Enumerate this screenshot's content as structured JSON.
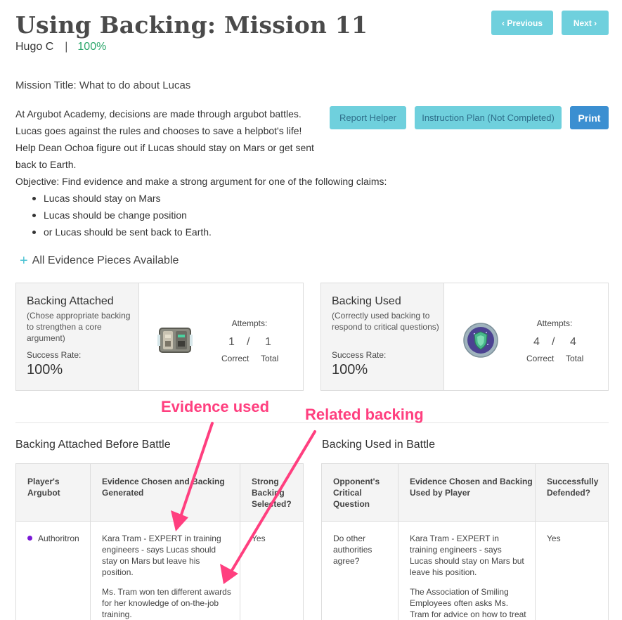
{
  "header": {
    "title": "Using Backing: Mission 11",
    "student": "Hugo C",
    "separator": "|",
    "progress": "100%",
    "prev_label": "‹ Previous",
    "next_label": "Next ›"
  },
  "mission": {
    "title": "Mission Title: What to do about Lucas",
    "description": "At Argubot Academy, decisions are made through argubot battles. Lucas goes against the rules and chooses to save a helpbot's life! Help Dean Ochoa figure out if Lucas should stay on Mars or get sent back to Earth.",
    "objective": "Objective: Find evidence and make a strong argument for one of the following claims:",
    "claims": [
      "Lucas should stay on Mars",
      "Lucas should be change position",
      "or Lucas should be sent back to Earth."
    ]
  },
  "actions": {
    "report_helper": "Report Helper",
    "instruction_plan": "Instruction Plan (Not Completed)",
    "print": "Print"
  },
  "evidence_toggle": {
    "icon": "plus-icon",
    "label": "All Evidence Pieces Available"
  },
  "cards": [
    {
      "title": "Backing Attached",
      "subtitle": "(Chose appropriate backing to strengthen a core argument)",
      "rate_label": "Success Rate:",
      "rate_value": "100%",
      "icon": "backing-device-icon",
      "attempts_label": "Attempts:",
      "correct": "1",
      "slash": "/",
      "total": "1",
      "correct_label": "Correct",
      "total_label": "Total"
    },
    {
      "title": "Backing Used",
      "subtitle": "(Correctly used backing to respond to critical questions)",
      "rate_label": "Success Rate:",
      "rate_value": "100%",
      "icon": "shield-badge-icon",
      "attempts_label": "Attempts:",
      "correct": "4",
      "slash": "/",
      "total": "4",
      "correct_label": "Correct",
      "total_label": "Total"
    }
  ],
  "annotations": {
    "evidence_used": "Evidence used",
    "related_backing": "Related backing",
    "color": "#ff3f7f"
  },
  "tables": [
    {
      "title": "Backing Attached Before Battle",
      "headers": [
        "Player's Argubot",
        "Evidence Chosen and Backing Generated",
        "Strong Backing Selected?"
      ],
      "row": {
        "argubot": "Authoritron",
        "evidence": "Kara Tram - EXPERT in training engineers - says Lucas should stay on Mars but leave his position.",
        "backing": "Ms. Tram won ten different awards for her knowledge of on-the-job training.",
        "strong": "Yes"
      }
    },
    {
      "title": "Backing Used in Battle",
      "headers": [
        "Opponent's Critical Question",
        "Evidence Chosen and Backing Used by Player",
        "Successfully Defended?"
      ],
      "row": {
        "question": "Do other authorities agree?",
        "evidence": "Kara Tram - EXPERT in training engineers - says Lucas should stay on Mars but leave his position.",
        "backing": "The Association of Smiling Employees often asks Ms. Tram for advice on how to treat",
        "defended": "Yes"
      }
    }
  ],
  "colors": {
    "accent_button": "#6fd0dd",
    "print_button": "#3b8fd1",
    "progress_green": "#2aa66a",
    "argubot_dot": "#7a18d6"
  }
}
